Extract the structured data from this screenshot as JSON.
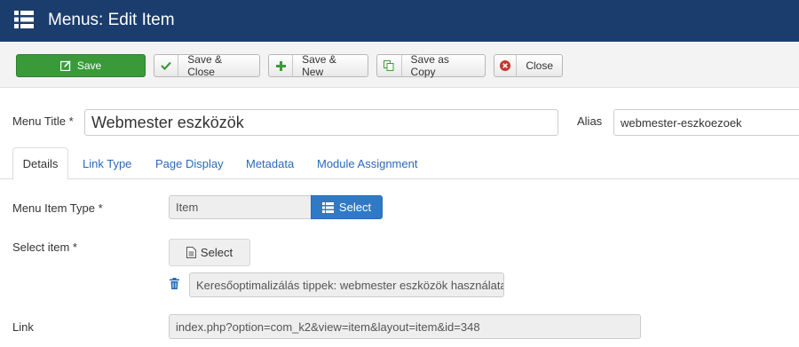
{
  "header": {
    "title": "Menus: Edit Item",
    "icon": "list-icon",
    "bg": "#1b3d6e"
  },
  "toolbar": {
    "save": "Save",
    "save_close": "Save & Close",
    "save_new": "Save & New",
    "save_copy": "Save as Copy",
    "close": "Close"
  },
  "form": {
    "menu_title_label": "Menu Title *",
    "menu_title_value": "Webmester eszközök",
    "alias_label": "Alias",
    "alias_value": "webmester-eszkoezoek"
  },
  "tabs": [
    "Details",
    "Link Type",
    "Page Display",
    "Metadata",
    "Module Assignment"
  ],
  "details": {
    "type_label": "Menu Item Type *",
    "type_value": "Item",
    "type_select": "Select",
    "select_item_label": "Select item *",
    "select_item_button": "Select",
    "selected_item": "Keresőoptimalizálás tippek: webmester eszközök használata",
    "link_label": "Link",
    "link_value": "index.php?option=com_k2&view=item&layout=item&id=348"
  }
}
